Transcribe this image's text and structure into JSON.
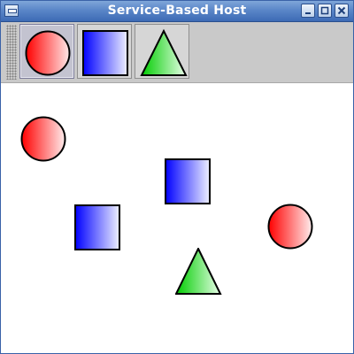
{
  "window": {
    "title": "Service-Based Host"
  },
  "toolbar": {
    "tools": [
      {
        "name": "circle",
        "selected": true
      },
      {
        "name": "square",
        "selected": false
      },
      {
        "name": "triangle",
        "selected": false
      }
    ]
  },
  "colors": {
    "title_bar": "#5a86c8",
    "circle_fill_start": "#ff0000",
    "circle_fill_end": "#ffffff",
    "square_fill_start": "#0000ff",
    "square_fill_end": "#ffffff",
    "triangle_fill_start": "#00cc00",
    "triangle_fill_end": "#ffffff"
  },
  "canvas": {
    "shapes": [
      {
        "type": "circle"
      },
      {
        "type": "square"
      },
      {
        "type": "square"
      },
      {
        "type": "circle"
      },
      {
        "type": "triangle"
      }
    ]
  }
}
